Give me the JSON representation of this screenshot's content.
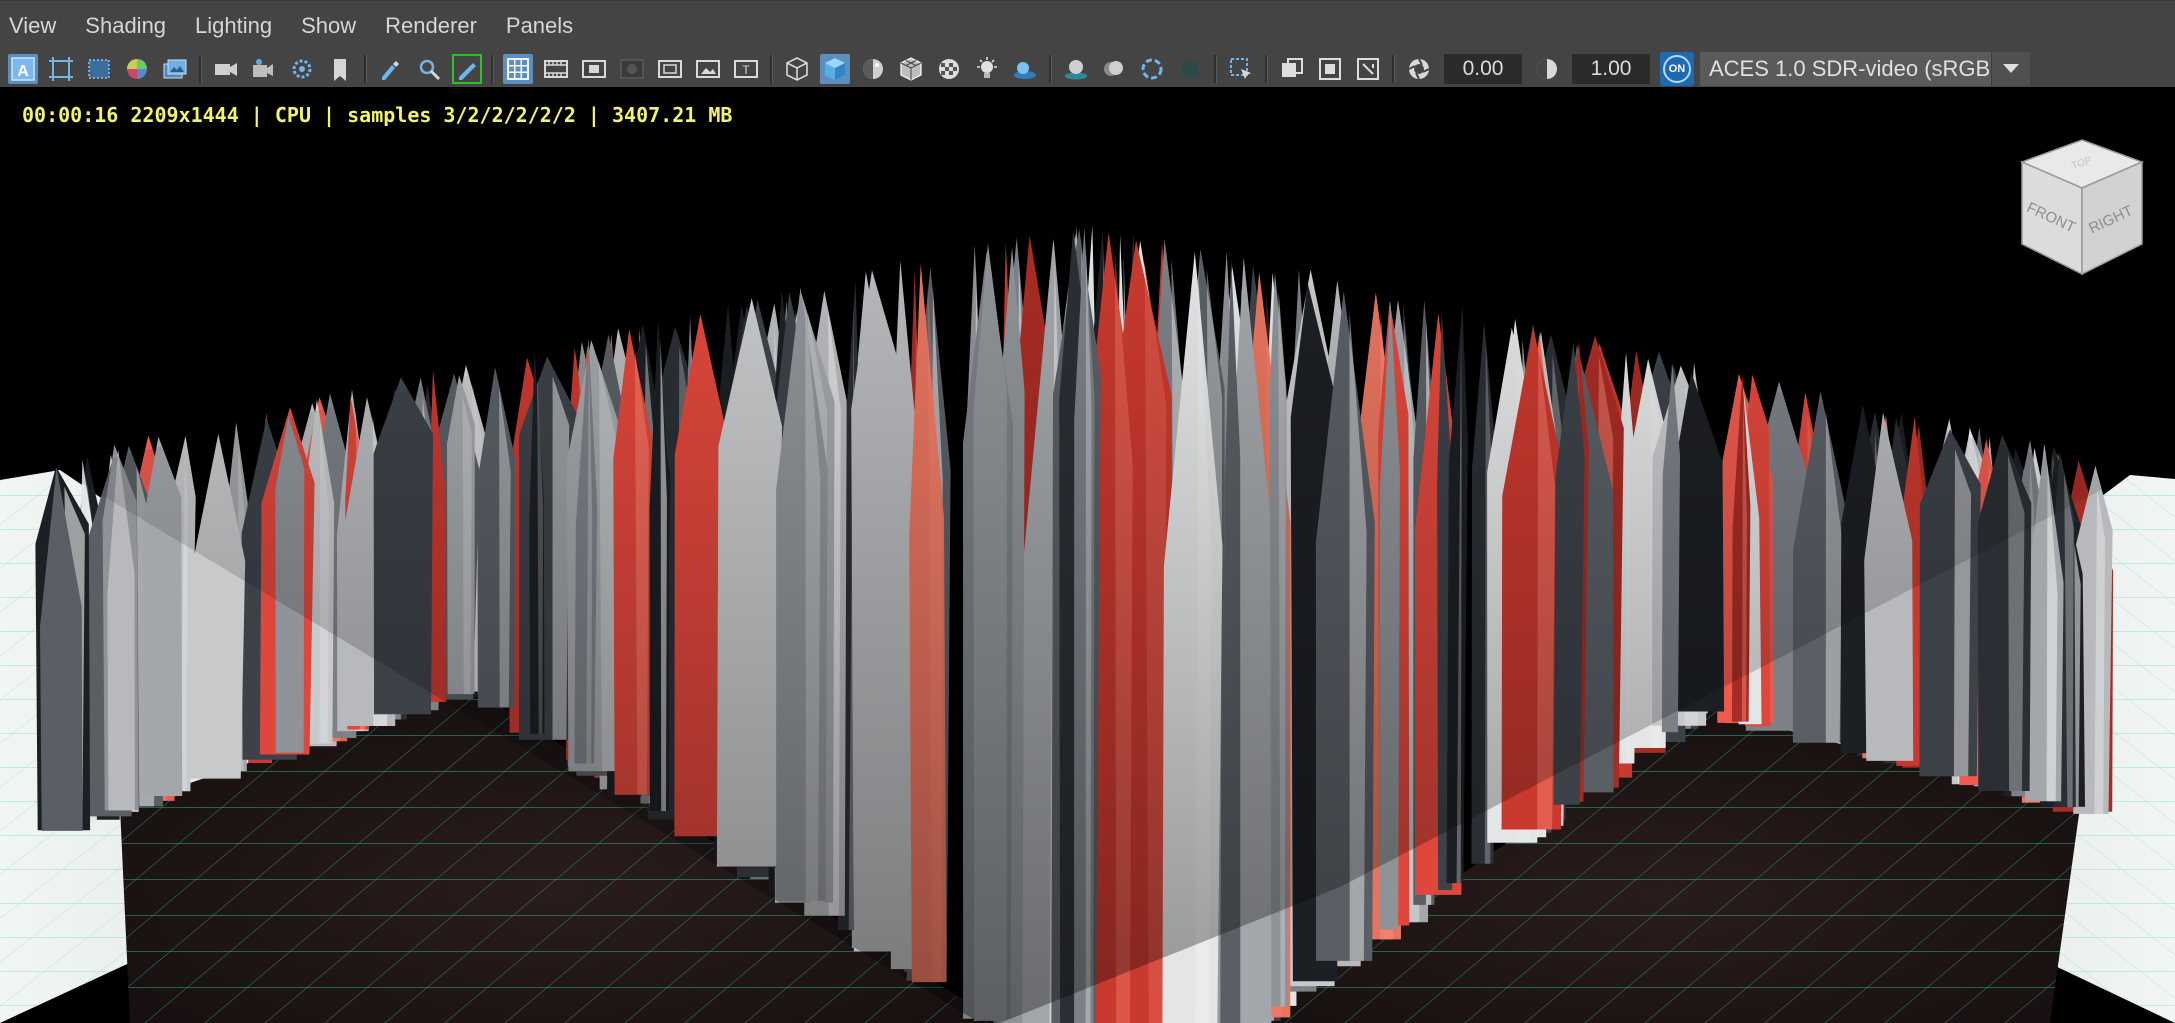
{
  "menu": [
    "View",
    "Shading",
    "Lighting",
    "Show",
    "Renderer",
    "Panels"
  ],
  "toolbar": {
    "exposure": "0.00",
    "gamma": "1.00",
    "color_management_toggle": "ON",
    "color_space": "ACES 1.0 SDR-video (sRGB)"
  },
  "hud": {
    "render_stats": "00:00:16 2209x1444 | CPU | samples 3/2/2/2/2/2 | 3407.21 MB"
  },
  "viewcube": {
    "top": "TOP",
    "front": "FRONT",
    "right": "RIGHT"
  },
  "icons": [
    "select-camera-icon",
    "camera-attributes-icon",
    "bookmark-icon",
    "image-plane-icon",
    "view-2d-pan-zoom-icon",
    "grease-pencil-icon",
    "grid-icon",
    "film-gate-icon",
    "resolution-gate-icon",
    "gate-mask-icon",
    "field-chart-icon",
    "safe-action-icon",
    "safe-title-icon",
    "wireframe-icon",
    "smooth-shade-icon",
    "use-default-material-icon",
    "wireframe-on-shaded-icon",
    "textured-icon",
    "use-all-lights-icon",
    "shadows-icon",
    "screen-space-ao-icon",
    "motion-blur-icon",
    "anti-aliasing-icon",
    "depth-of-field-icon",
    "isolate-select-icon",
    "xray-icon",
    "xray-joints-icon",
    "xray-components-icon",
    "exposure-icon",
    "gamma-icon"
  ],
  "colors": {
    "panel_bg": "#444444",
    "hud_text": "#f3f36a",
    "active_button": "#5c8fbe",
    "grid_line": "#3fe0b0",
    "accent_red": "#e0473c"
  }
}
